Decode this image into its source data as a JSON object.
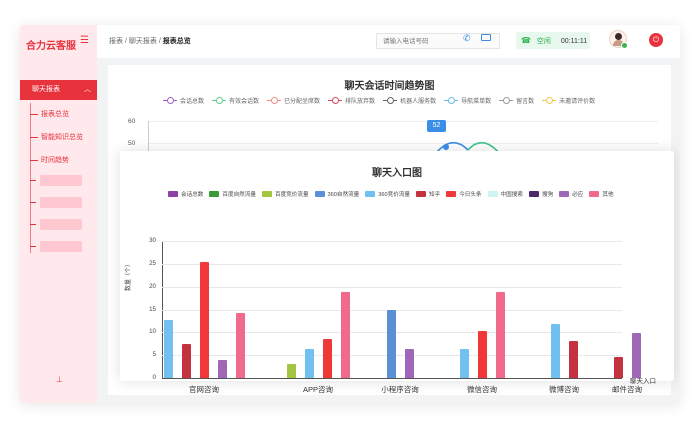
{
  "sidebar": {
    "brand": "合力云客服",
    "menu_icon": "menu-icon",
    "active_item": "聊天报表",
    "sub_items": [
      "报表总览",
      "智能知识总览",
      "时间趋势"
    ]
  },
  "header": {
    "breadcrumb_1": "报表",
    "breadcrumb_2": "聊天报表",
    "breadcrumb_current": "报表总览",
    "separator": "/",
    "phone_placeholder": "请输入电话号码",
    "status_label": "空闲",
    "timer": "00:11:11"
  },
  "back_chart": {
    "title": "聊天会话时间趋势图",
    "legend": [
      {
        "name": "会话总数",
        "color": "#a65fc9"
      },
      {
        "name": "有效会话数",
        "color": "#5fcf8a"
      },
      {
        "name": "已分配坐席数",
        "color": "#f08c8c"
      },
      {
        "name": "排队放弃数",
        "color": "#d9475b"
      },
      {
        "name": "机器人服务数",
        "color": "#666666"
      },
      {
        "name": "导航菜单数",
        "color": "#6cb8e8"
      },
      {
        "name": "留言数",
        "color": "#9a9a9a"
      },
      {
        "name": "未邀请评价数",
        "color": "#f2c94c"
      }
    ],
    "y_ticks": [
      "60",
      "50"
    ],
    "tooltip_value": "52"
  },
  "chart_data": {
    "type": "bar",
    "title": "聊天入口图",
    "ylabel": "数量（个）",
    "xlabel": "聊天入口",
    "ylim": [
      0,
      30
    ],
    "y_ticks": [
      "0",
      "5",
      "10",
      "15",
      "20",
      "25",
      "30"
    ],
    "categories": [
      "官网咨询",
      "APP咨询",
      "小程序咨询",
      "微信咨询",
      "微博咨询",
      "邮件咨询"
    ],
    "series": [
      {
        "name": "会话总数",
        "color": "#8e3fa8",
        "values": [
          0,
          0,
          0,
          0,
          0,
          0
        ]
      },
      {
        "name": "百度自然流量",
        "color": "#3a9a3a",
        "values": [
          0,
          0,
          0,
          0,
          0,
          0
        ]
      },
      {
        "name": "百度竞价流量",
        "color": "#a4c53f",
        "values": [
          0,
          3,
          0,
          0,
          0,
          0
        ]
      },
      {
        "name": "360自然流量",
        "color": "#5b8fd6",
        "values": [
          0,
          0,
          15,
          0,
          0,
          0
        ]
      },
      {
        "name": "360竞价流量",
        "color": "#70c1f0",
        "values": [
          12.8,
          6.4,
          0,
          6.4,
          11.8,
          0
        ]
      },
      {
        "name": "知乎",
        "color": "#c4323f",
        "values": [
          7.4,
          0,
          0,
          0,
          8,
          4.6
        ]
      },
      {
        "name": "今日头条",
        "color": "#f03838",
        "values": [
          25.3,
          8.6,
          0,
          10.2,
          0,
          0
        ]
      },
      {
        "name": "中国搜索",
        "color": "#d0f4f4",
        "values": [
          0,
          0,
          0,
          0,
          0,
          0
        ]
      },
      {
        "name": "搜狗",
        "color": "#4a2a6a",
        "values": [
          0,
          0,
          0,
          0,
          0,
          0
        ]
      },
      {
        "name": "必应",
        "color": "#a066b8",
        "values": [
          4,
          0,
          6.4,
          0,
          0,
          9.8
        ]
      },
      {
        "name": "其他",
        "color": "#f06a8c",
        "values": [
          14.2,
          18.8,
          0,
          18.8,
          0,
          0
        ]
      }
    ]
  }
}
